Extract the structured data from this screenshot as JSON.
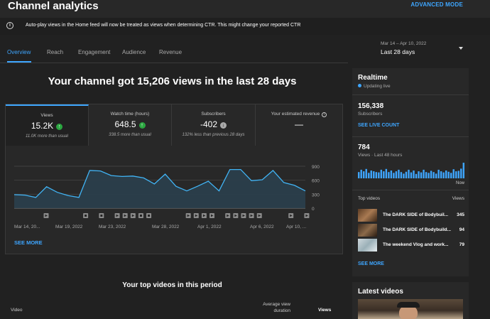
{
  "header": {
    "title": "Channel analytics",
    "advanced_mode": "ADVANCED MODE"
  },
  "notice": {
    "icon": "info-icon",
    "text": "Auto-play views in the Home feed will now be treated as views when determining CTR. This might change your reported CTR"
  },
  "tabs": [
    {
      "label": "Overview",
      "active": true
    },
    {
      "label": "Reach",
      "active": false
    },
    {
      "label": "Engagement",
      "active": false
    },
    {
      "label": "Audience",
      "active": false
    },
    {
      "label": "Revenue",
      "active": false
    }
  ],
  "date_range": {
    "sub": "Mar 14 – Apr 10, 2022",
    "main": "Last 28 days"
  },
  "headline": "Your channel got 15,206 views in the last 28 days",
  "metrics": [
    {
      "label": "Views",
      "value": "15.2K",
      "sub": "11.0K more than usual",
      "trend": "up",
      "selected": true
    },
    {
      "label": "Watch time (hours)",
      "value": "648.5",
      "sub": "338.5 more than usual",
      "trend": "up",
      "selected": false
    },
    {
      "label": "Subscribers",
      "value": "-402",
      "sub": "132% less than previous 28 days",
      "trend": "down",
      "selected": false
    },
    {
      "label": "Your estimated revenue",
      "value": "—",
      "sub": "",
      "trend": "none",
      "selected": false
    }
  ],
  "chart_data": {
    "type": "area",
    "y_ticks": [
      "900",
      "600",
      "300",
      "0"
    ],
    "ylim": [
      0,
      900
    ],
    "x_tick_labels": [
      "Mar 14, 20...",
      "Mar 19, 2022",
      "Mar 23, 2022",
      "Mar 28, 2022",
      "Apr 1, 2022",
      "Apr 6, 2022",
      "Apr 10, ..."
    ],
    "series": [
      {
        "values": [
          290,
          280,
          230,
          460,
          340,
          270,
          230,
          810,
          800,
          700,
          680,
          690,
          650,
          520,
          730,
          470,
          370,
          470,
          580,
          370,
          830,
          830,
          590,
          610,
          810,
          550,
          490,
          370
        ]
      }
    ],
    "video_markers": [
      1,
      0,
      0,
      0,
      0,
      1,
      0,
      1,
      0,
      1,
      1,
      1,
      1,
      1,
      0,
      0,
      0,
      0,
      1,
      1,
      1,
      1,
      0,
      1,
      1,
      1,
      1,
      1,
      0,
      0,
      0,
      1,
      0,
      1
    ],
    "marker_types": [
      "play",
      "",
      "",
      "",
      "",
      "square",
      "",
      "square",
      "",
      "play",
      "play",
      "play",
      "square",
      "square",
      "",
      "",
      "",
      "",
      "play",
      "play",
      "play",
      "play",
      "",
      "play",
      "play",
      "play",
      "play",
      "play",
      "",
      "",
      "",
      "play",
      "",
      "play"
    ],
    "grid": true
  },
  "see_more": "SEE MORE",
  "top_videos": {
    "title": "Your top videos in this period",
    "col_video": "Video",
    "col_avd": "Average view duration",
    "col_views": "Views"
  },
  "realtime": {
    "title": "Realtime",
    "live": "Updating live",
    "subscribers": "156,338",
    "subscribers_label": "Subscribers",
    "see_live_count": "SEE LIVE COUNT",
    "views": "784",
    "views_label": "Views · Last 48 hours",
    "now_label": "Now",
    "bars": [
      40,
      55,
      45,
      60,
      35,
      50,
      45,
      40,
      38,
      55,
      45,
      60,
      40,
      50,
      35,
      45,
      55,
      40,
      30,
      42,
      55,
      38,
      50,
      28,
      45,
      38,
      55,
      40,
      35,
      48,
      40,
      30,
      55,
      45,
      38,
      50,
      42,
      35,
      58,
      45,
      48,
      62,
      100
    ],
    "top_videos_label": "Top videos",
    "views_col": "Views",
    "videos": [
      {
        "title": "The DARK SIDE of Bodybuil...",
        "views": "345"
      },
      {
        "title": "The DARK SIDE of Bodybuild...",
        "views": "94"
      },
      {
        "title": "The weekend Vlog and work...",
        "views": "79"
      }
    ],
    "see_more": "SEE MORE"
  },
  "latest_videos": {
    "title": "Latest videos"
  }
}
